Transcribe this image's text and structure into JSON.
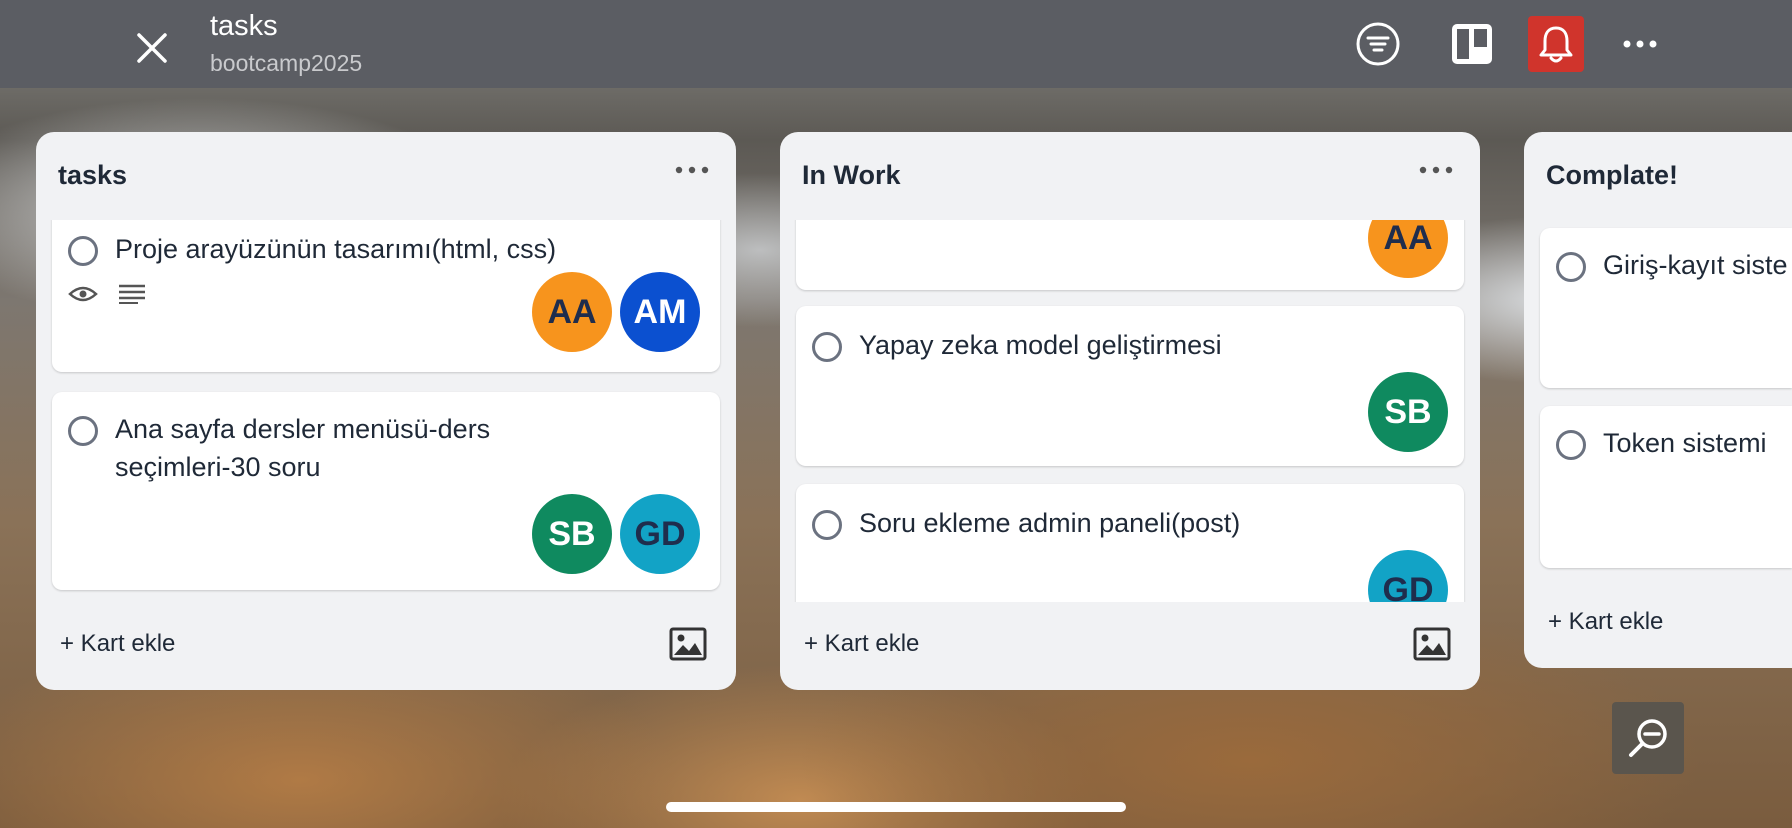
{
  "header": {
    "title": "tasks",
    "subtitle": "bootcamp2025",
    "icons": [
      "close-icon",
      "filter-icon",
      "board-view-icon",
      "bell-icon",
      "more-icon"
    ],
    "notification_color": "#d0342c"
  },
  "lists": [
    {
      "title": "tasks",
      "add_label": "+ Kart ekle",
      "cards": [
        {
          "text": "Proje arayüzünün tasarımı(html, css)",
          "badges": [
            "eye-icon",
            "description-icon"
          ],
          "avatars": [
            "AA",
            "AM"
          ]
        },
        {
          "text": "Ana sayfa dersler menüsü-ders seçimleri-30 soru",
          "avatars": [
            "SB",
            "GD"
          ]
        }
      ]
    },
    {
      "title": "In Work",
      "add_label": "+ Kart ekle",
      "cards": [
        {
          "text": "",
          "avatars": [
            "AA"
          ]
        },
        {
          "text": "Yapay zeka model geliştirmesi",
          "avatars": [
            "SB"
          ]
        },
        {
          "text": "Soru ekleme admin paneli(post)",
          "avatars": [
            "GD"
          ]
        }
      ]
    },
    {
      "title": "Complate!",
      "add_label": "+ Kart ekle",
      "cards": [
        {
          "text": "Giriş-kayıt siste"
        },
        {
          "text": "Token sistemi"
        }
      ]
    }
  ],
  "avatar_colors": {
    "AA": {
      "bg": "#f7941d",
      "fg": "#1f2d4d"
    },
    "AM": {
      "bg": "#0b50d0",
      "fg": "#ffffff"
    },
    "SB": {
      "bg": "#0f8a5f",
      "fg": "#ffffff"
    },
    "GD": {
      "bg": "#12a3c6",
      "fg": "#1f2d4d"
    }
  }
}
